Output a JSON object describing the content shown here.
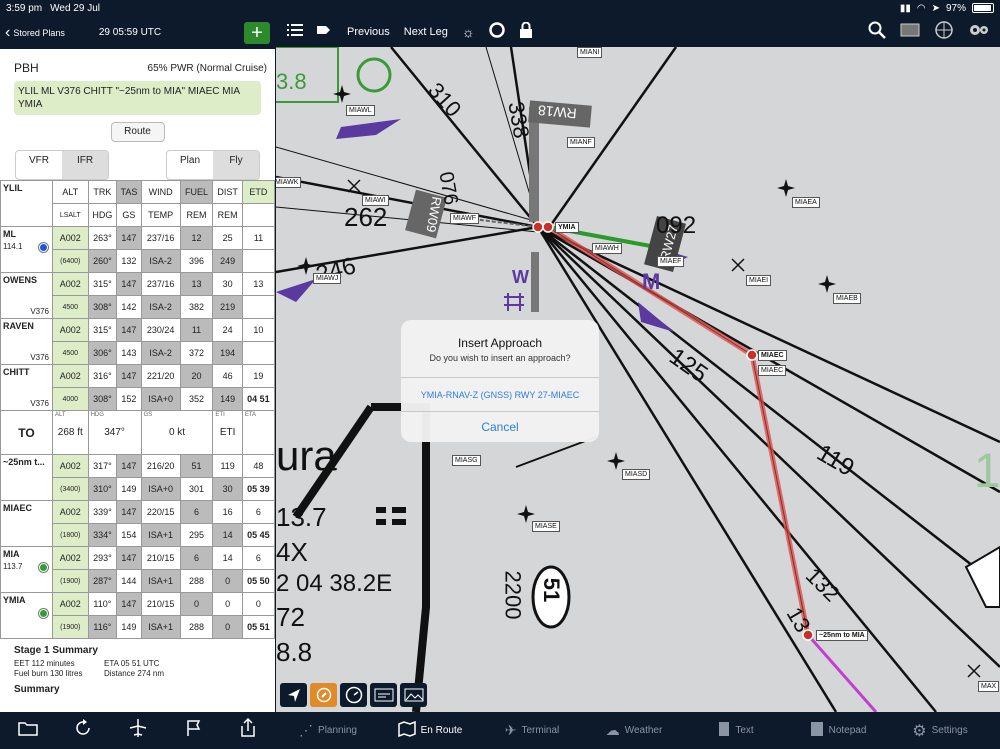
{
  "status": {
    "time": "3:59 pm",
    "date": "Wed 29 Jul",
    "battery": "97%"
  },
  "left_header": {
    "back_label": "Stored Plans",
    "time": "29 05:59 UTC",
    "add_label": "+"
  },
  "plan": {
    "aircraft": "PBH",
    "power": "65% PWR (Normal Cruise)",
    "route": "YLIL ML V376 CHITT \"~25nm to MIA\" MIAEC MIA YMIA",
    "route_button": "Route"
  },
  "segments": {
    "vfr": "VFR",
    "ifr": "IFR",
    "plan": "Plan",
    "fly": "Fly"
  },
  "table": {
    "origin": "YLIL",
    "hdr1": [
      "ALT",
      "TRK",
      "TAS",
      "WIND",
      "FUEL",
      "DIST",
      "ETD"
    ],
    "hdr2": [
      "LSALT",
      "HDG",
      "GS",
      "TEMP",
      "REM",
      "REM"
    ],
    "rows": [
      {
        "name": "ML",
        "freq": "114.1",
        "sub": "",
        "dot": "blue",
        "r1": [
          "A002",
          "263°",
          "147",
          "237/16",
          "12",
          "25",
          "11"
        ],
        "r2": [
          "(6400)",
          "260°",
          "132",
          "ISA-2",
          "396",
          "249",
          ""
        ]
      },
      {
        "name": "OWENS",
        "freq": "",
        "sub": "V376",
        "dot": "",
        "r1": [
          "A002",
          "315°",
          "147",
          "237/16",
          "13",
          "30",
          "13"
        ],
        "r2": [
          "4500",
          "308°",
          "142",
          "ISA-2",
          "382",
          "219",
          ""
        ]
      },
      {
        "name": "RAVEN",
        "freq": "",
        "sub": "V376",
        "dot": "",
        "r1": [
          "A002",
          "315°",
          "147",
          "230/24",
          "11",
          "24",
          "10"
        ],
        "r2": [
          "4500",
          "306°",
          "143",
          "ISA-2",
          "372",
          "194",
          ""
        ]
      },
      {
        "name": "CHITT",
        "freq": "",
        "sub": "V376",
        "dot": "",
        "r1": [
          "A002",
          "316°",
          "147",
          "221/20",
          "20",
          "46",
          "19"
        ],
        "r2": [
          "4000",
          "308°",
          "152",
          "ISA+0",
          "352",
          "149",
          "04 51"
        ]
      }
    ],
    "to": {
      "label": "TO",
      "alt_lbl": "ALT",
      "alt": "268 ft",
      "hdg_lbl": "HDG",
      "hdg": "347°",
      "gs_lbl": "GS",
      "gs": "0 kt",
      "eti_lbl": "ETI",
      "eti": "ETI",
      "eta_lbl": "ETA"
    },
    "rows2": [
      {
        "name": "~25nm t...",
        "freq": "",
        "sub": "",
        "dot": "",
        "r1": [
          "A002",
          "317°",
          "147",
          "216/20",
          "51",
          "119",
          "48"
        ],
        "r2": [
          "(3400)",
          "310°",
          "149",
          "ISA+0",
          "301",
          "30",
          "05 39"
        ]
      },
      {
        "name": "MIAEC",
        "freq": "",
        "sub": "",
        "dot": "",
        "r1": [
          "A002",
          "339°",
          "147",
          "220/15",
          "6",
          "16",
          "6"
        ],
        "r2": [
          "(1800)",
          "334°",
          "154",
          "ISA+1",
          "295",
          "14",
          "05 45"
        ]
      },
      {
        "name": "MIA",
        "freq": "113.7",
        "sub": "",
        "dot": "green",
        "r1": [
          "A002",
          "293°",
          "147",
          "210/15",
          "6",
          "14",
          "6"
        ],
        "r2": [
          "(1900)",
          "287°",
          "144",
          "ISA+1",
          "288",
          "0",
          "05 50"
        ]
      },
      {
        "name": "YMIA",
        "freq": "",
        "sub": "",
        "dot": "green",
        "r1": [
          "A002",
          "110°",
          "147",
          "210/15",
          "0",
          "0",
          "0"
        ],
        "r2": [
          "(1900)",
          "116°",
          "149",
          "ISA+1",
          "288",
          "0",
          "05 51"
        ]
      }
    ]
  },
  "summary": {
    "title": "Stage 1 Summary",
    "eet": "EET 112 minutes",
    "eta": "ETA 05 51 UTC",
    "fuel": "Fuel burn 130 litres",
    "distance": "Distance 274 nm",
    "summary_label": "Summary"
  },
  "toolbar": {
    "previous": "Previous",
    "next_leg": "Next Leg"
  },
  "map": {
    "labels": {
      "rw18": "RW18",
      "rw09": "RW09",
      "rw27": "RW27",
      "n310": "310",
      "n338": "338",
      "n262": "262",
      "n246": "246",
      "n125": "125",
      "n119": "119",
      "n132": "132",
      "n13x": "13",
      "n2200": "2200",
      "n51": "51",
      "n076": "076",
      "n092": "092",
      "ura": "ura",
      "t137": "13.7",
      "t4x": "4X",
      "tcoord": "2 04 38.2E",
      "t72": "72",
      "t188": "8.8",
      "t38": "3.8",
      "w": "W",
      "m": "M"
    },
    "tags": {
      "miani": "MIANI",
      "miawl": "MIAWL",
      "mianf": "MIANF",
      "miawk": "MIAWK",
      "miawi": "MIAWI",
      "miawf": "MIAWF",
      "ymia": "YMIA",
      "miawh": "MIAWH",
      "miaef": "MIAEF",
      "miaea": "MIAEA",
      "miawj": "MIAWJ",
      "miaei": "MIAEI",
      "miaeb": "MIAEB",
      "miaec": "MIAEC",
      "miaec2": "MIAEC",
      "miasg": "MIASG",
      "miasd": "MIASD",
      "miase": "MIASE",
      "to25": "~25nm to MIA",
      "maxx": "MAX"
    }
  },
  "alert": {
    "title": "Insert Approach",
    "message": "Do you wish to insert an approach?",
    "option": "YMIA-RNAV-Z (GNSS) RWY 27-MIAEC",
    "cancel": "Cancel"
  },
  "bottom_nav": {
    "planning": "Planning",
    "en_route": "En Route",
    "terminal": "Terminal",
    "weather": "Weather",
    "text": "Text",
    "notepad": "Notepad",
    "settings": "Settings"
  },
  "colors": {
    "bg": "#0c1a2b",
    "green_cell": "#dcedc8",
    "gray_cell": "#bbbbbb",
    "route_red": "#d9534f",
    "accent": "#2b7de0"
  }
}
